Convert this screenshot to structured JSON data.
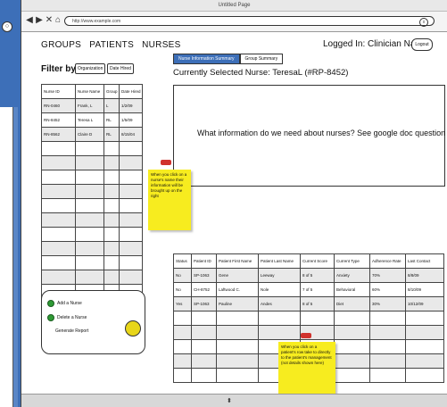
{
  "window": {
    "title": "Untitled Page"
  },
  "browser": {
    "url": "http://www.example.com",
    "clear_glyph": "x"
  },
  "nav": {
    "items": [
      "GROUPS",
      "PATIENTS",
      "NURSES"
    ]
  },
  "filter": {
    "label": "Filter by",
    "buttons": [
      "Organization",
      "Date Hired"
    ]
  },
  "nurses_table": {
    "headers": [
      "Nurse ID",
      "Nurse Name",
      "Group",
      "Date Hired"
    ],
    "rows": [
      [
        "RN-0460",
        "Frank, L",
        "L",
        "1/2/09"
      ],
      [
        "RN-8452",
        "Teresa L",
        "RL",
        "1/5/09"
      ],
      [
        "RN-8562",
        "Claire D",
        "RL",
        "8/15/04"
      ]
    ]
  },
  "left_panel": {
    "items": [
      "Add a Nurse",
      "Delete a Nurse",
      "Generate Report"
    ]
  },
  "tabs": [
    "Nurse Information Summary",
    "Group Summary"
  ],
  "selected_nurse": "Currently Selected Nurse: TeresaL (#RP-8452)",
  "account": {
    "logged_in": "Logged In: Clinician Name",
    "logout": "Logout"
  },
  "info_box": {
    "text": "What information do we need about nurses? See google doc question one."
  },
  "patients_table": {
    "headers": [
      "Status",
      "Patient ID",
      "Patient First Name",
      "Patient Last Name",
      "Current Score",
      "Current Type",
      "Adherence Rate",
      "Last Contact"
    ],
    "rows": [
      [
        "No",
        "SP-1063",
        "Gene",
        "Leeway",
        "8 of 5",
        "Anxiety",
        "70%",
        "8/8/09"
      ],
      [
        "No",
        "CH-8752",
        "Laftwood C.",
        "Nole",
        "7 of 5",
        "Behavioral",
        "60%",
        "8/10/09"
      ],
      [
        "Yes",
        "SP-1063",
        "Pauline",
        "Andes",
        "8 of 5",
        "Diet",
        "30%",
        "10/12/09"
      ]
    ]
  },
  "notes": {
    "note1": "When you click on a nurse's name their information will be brought up on the right",
    "note2": "When you click on a patient's row take to directly to the patient's management (not details shown here)"
  }
}
